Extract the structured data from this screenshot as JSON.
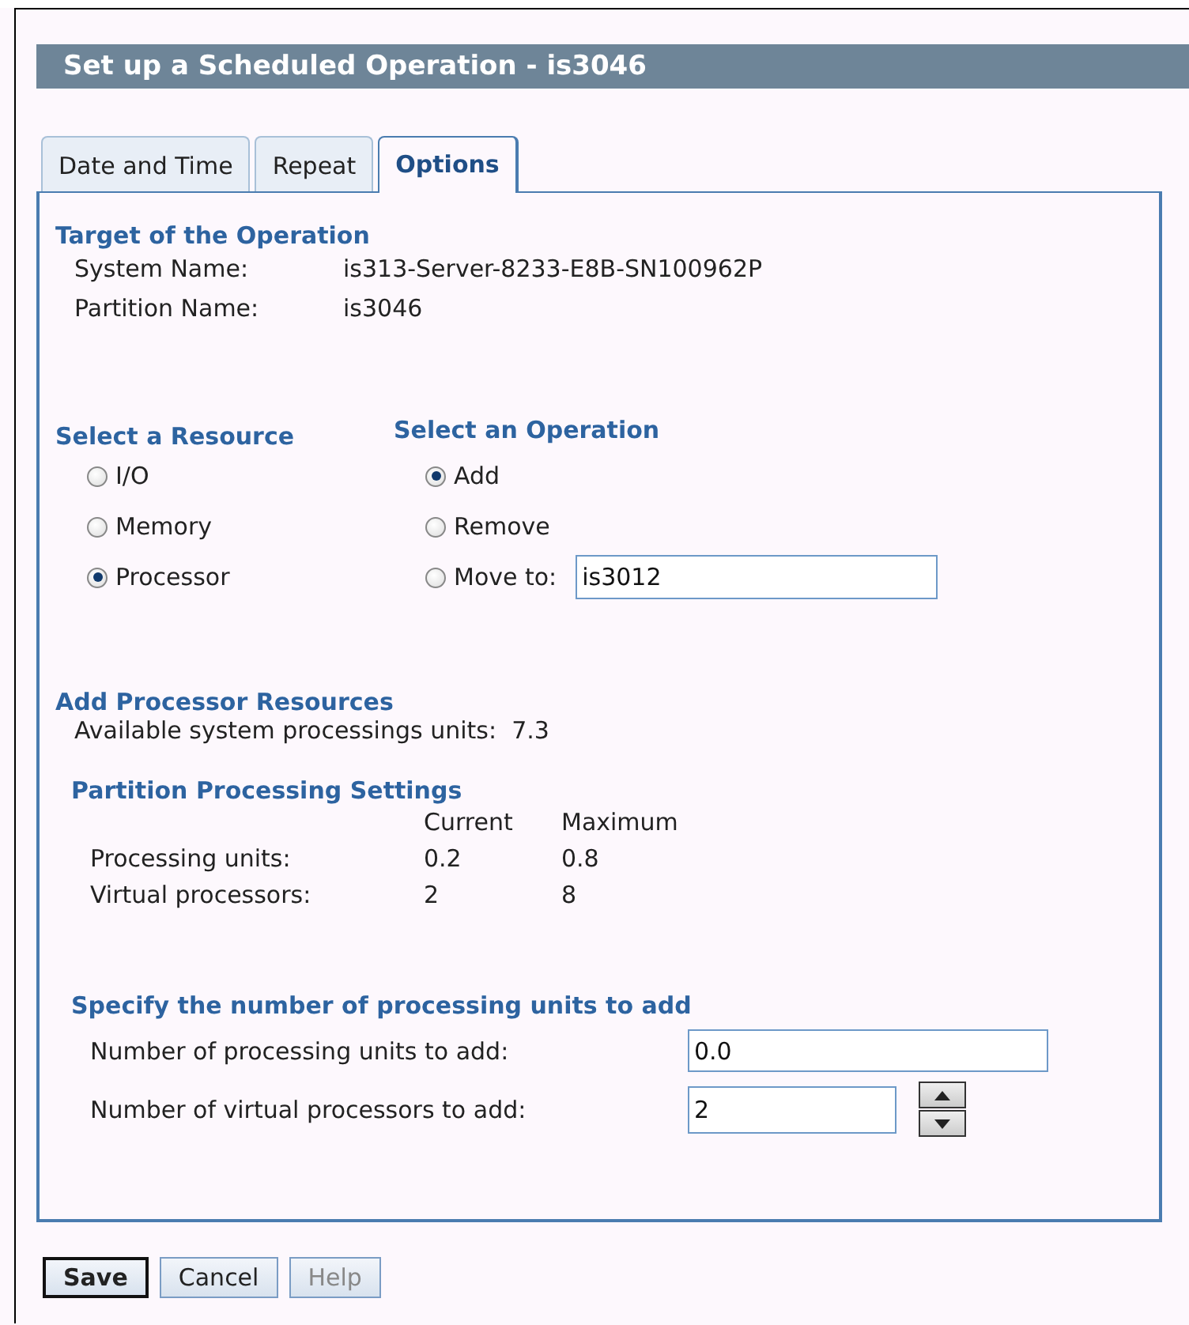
{
  "window": {
    "title": "Set up a Scheduled Operation - is3046"
  },
  "tabs": [
    {
      "label": "Date and Time",
      "selected": false
    },
    {
      "label": "Repeat",
      "selected": false
    },
    {
      "label": "Options",
      "selected": true
    }
  ],
  "target": {
    "heading": "Target of the Operation",
    "rows": [
      {
        "label": "System Name:",
        "value": "is313-Server-8233-E8B-SN100962P"
      },
      {
        "label": "Partition Name:",
        "value": "is3046"
      }
    ]
  },
  "resource": {
    "heading": "Select a Resource",
    "options": [
      {
        "label": "I/O",
        "selected": false
      },
      {
        "label": "Memory",
        "selected": false
      },
      {
        "label": "Processor",
        "selected": true
      }
    ]
  },
  "operation": {
    "heading": "Select an Operation",
    "options": [
      {
        "label": "Add",
        "selected": true
      },
      {
        "label": "Remove",
        "selected": false
      },
      {
        "label": "Move to:",
        "selected": false,
        "field": {
          "value": "is3012"
        }
      }
    ]
  },
  "add_section": {
    "heading": "Add Processor Resources",
    "available": {
      "label": "Available system processings units:",
      "value": "7.3"
    }
  },
  "settings": {
    "heading": "Partition Processing Settings",
    "columns": [
      "Current",
      "Maximum"
    ],
    "rows": [
      {
        "label": "Processing units:",
        "values": [
          "0.2",
          "0.8"
        ]
      },
      {
        "label": "Virtual processors:",
        "values": [
          "2",
          "8"
        ]
      }
    ]
  },
  "specify": {
    "heading": "Specify the number of processing units to add",
    "fields": [
      {
        "kind": "text",
        "label": "Number of processing units to add:",
        "value": "0.0"
      },
      {
        "kind": "spinner",
        "label": "Number of virtual processors to add:",
        "value": "2"
      }
    ]
  },
  "buttons": [
    {
      "label": "Save",
      "default": true,
      "disabled": false
    },
    {
      "label": "Cancel",
      "default": false,
      "disabled": false
    },
    {
      "label": "Help",
      "default": false,
      "disabled": true
    }
  ]
}
